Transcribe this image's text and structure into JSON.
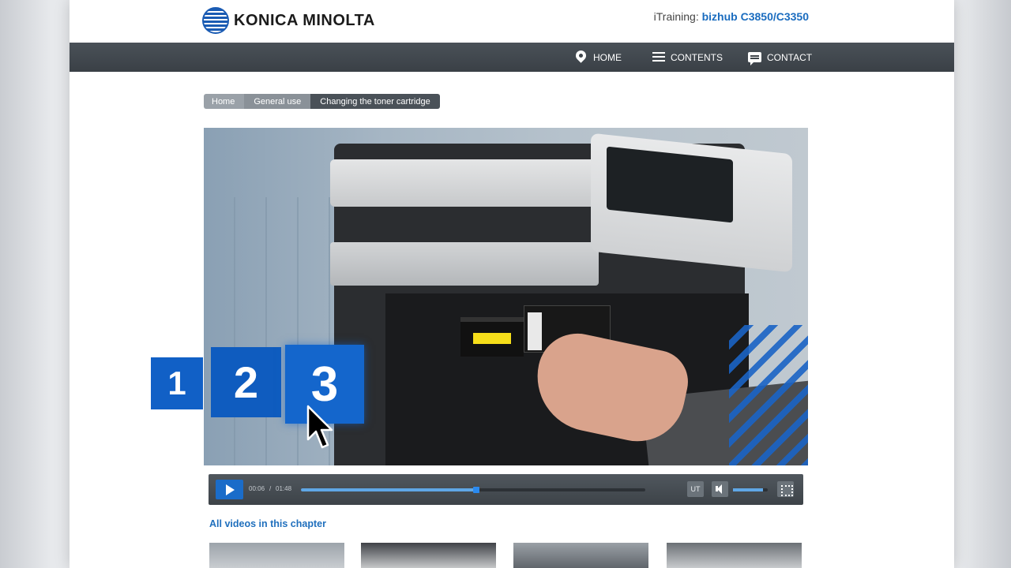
{
  "header": {
    "logo_text": "KONICA MINOLTA",
    "itraining_prefix": "iTraining: ",
    "model": "bizhub C3850/C3350"
  },
  "nav": {
    "items": [
      {
        "label": "HOME",
        "icon": "pin-icon"
      },
      {
        "label": "CONTENTS",
        "icon": "list-icon"
      },
      {
        "label": "CONTACT",
        "icon": "chat-icon"
      }
    ]
  },
  "breadcrumb": [
    "Home",
    "General use",
    "Changing the toner cartridge"
  ],
  "steps": [
    "1",
    "2",
    "3"
  ],
  "player": {
    "current_time": "00:06",
    "separator": "/",
    "duration": "01:48",
    "progress_fraction": 0.51,
    "volume_fraction": 0.86,
    "subtitle_label": "UT"
  },
  "chapter": {
    "title": "All videos in this chapter"
  },
  "colors": {
    "accent": "#1a6cbf",
    "nav_bg": "#3f454b",
    "step_blue": "#1160c6"
  }
}
